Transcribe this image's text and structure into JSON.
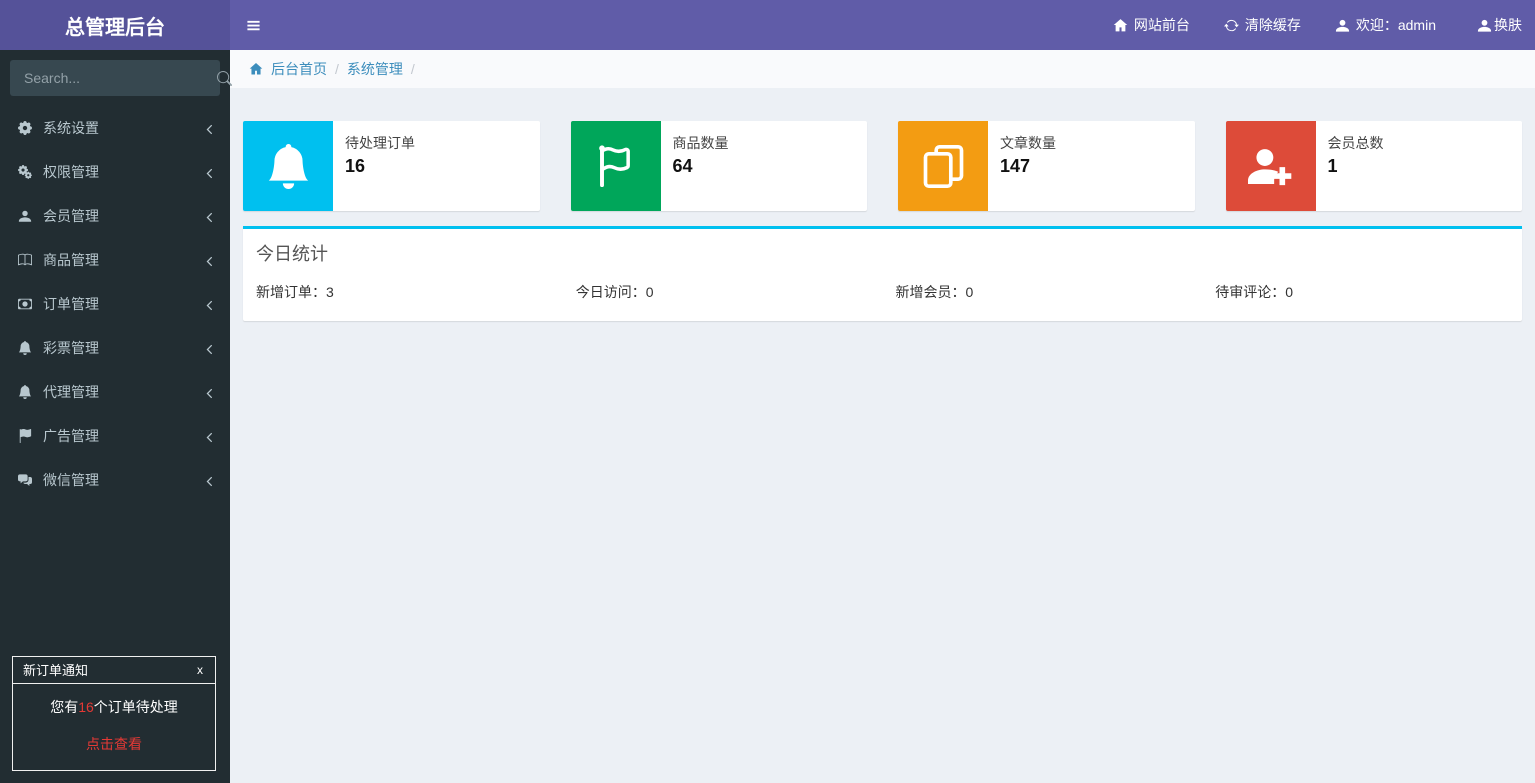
{
  "header": {
    "logo": "总管理后台",
    "nav": [
      {
        "icon": "home-icon",
        "label": "网站前台"
      },
      {
        "icon": "refresh-icon",
        "label": "清除缓存"
      },
      {
        "icon": "user-icon",
        "label": "欢迎：admin"
      },
      {
        "icon": "person-icon",
        "label": "换肤"
      }
    ]
  },
  "sidebar": {
    "search_placeholder": "Search...",
    "menu": [
      {
        "icon": "gear-icon",
        "label": "系统设置"
      },
      {
        "icon": "gears-icon",
        "label": "权限管理"
      },
      {
        "icon": "user-icon",
        "label": "会员管理"
      },
      {
        "icon": "book-icon",
        "label": "商品管理"
      },
      {
        "icon": "money-icon",
        "label": "订单管理"
      },
      {
        "icon": "bell-icon",
        "label": "彩票管理"
      },
      {
        "icon": "bell-icon",
        "label": "代理管理"
      },
      {
        "icon": "flag-icon",
        "label": "广告管理"
      },
      {
        "icon": "comments-icon",
        "label": "微信管理"
      }
    ]
  },
  "breadcrumb": {
    "items": [
      "后台首页",
      "系统管理"
    ],
    "separator": "/"
  },
  "stat_cards": [
    {
      "label": "待处理订单",
      "value": "16",
      "color": "#00c0ef",
      "icon": "bell-icon"
    },
    {
      "label": "商品数量",
      "value": "64",
      "color": "#00a65a",
      "icon": "flag-icon"
    },
    {
      "label": "文章数量",
      "value": "147",
      "color": "#f39c12",
      "icon": "copy-icon"
    },
    {
      "label": "会员总数",
      "value": "1",
      "color": "#dd4b39",
      "icon": "user-plus-icon"
    }
  ],
  "today_panel": {
    "title": "今日统计",
    "stats": [
      {
        "label": "新增订单",
        "value": "3",
        "text": "新增订单：3"
      },
      {
        "label": "今日访问",
        "value": "0",
        "text": "今日访问：0"
      },
      {
        "label": "新增会员",
        "value": "0",
        "text": "新增会员：0"
      },
      {
        "label": "待审评论",
        "value": "0",
        "text": "待审评论：0"
      }
    ]
  },
  "notification": {
    "title": "新订单通知",
    "close": "x",
    "message_prefix": "您有",
    "message_count": "16",
    "message_suffix": "个订单待处理",
    "link": "点击查看"
  },
  "colors": {
    "navbar_purple": "#605ca8",
    "logo_purple": "#555299",
    "sidebar_dark": "#222d32",
    "content_bg": "#ecf0f5",
    "link_blue": "#3c8dbc",
    "aqua": "#00c0ef",
    "green": "#00a65a",
    "yellow": "#f39c12",
    "red": "#dd4b39",
    "alert_red": "#e53935"
  }
}
